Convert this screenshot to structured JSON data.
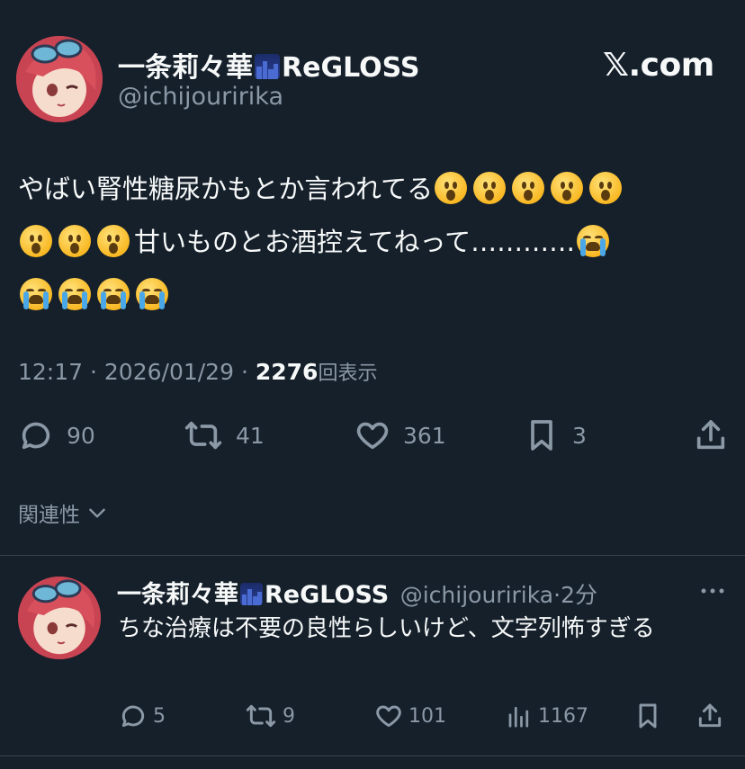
{
  "site_label": "𝕏.com",
  "tweet": {
    "author_name": "一条莉々華",
    "author_suffix": "ReGLOSS",
    "handle": "@ichijouririka",
    "text_line1": "やばい腎性糖尿かもとか言われてる",
    "text_line2": "甘いものとお酒控えてねって…………",
    "time": "12:17",
    "date": "2026/01/29",
    "views": "2276",
    "views_label": "回表示",
    "replies": "90",
    "retweets": "41",
    "likes": "361",
    "bookmarks": "3"
  },
  "related_label": "関連性",
  "reply": {
    "author_name": "一条莉々華",
    "author_suffix": "ReGLOSS",
    "handle": "@ichijouririka",
    "time_ago": "2分",
    "text": "ちな治療は不要の良性らしいけど、文字列怖すぎる",
    "replies": "5",
    "retweets": "9",
    "likes": "101",
    "views": "1167"
  },
  "colors": {
    "background": "#15202b",
    "text": "#f7f9f9",
    "muted": "#8b98a5",
    "divider": "#38444d"
  }
}
